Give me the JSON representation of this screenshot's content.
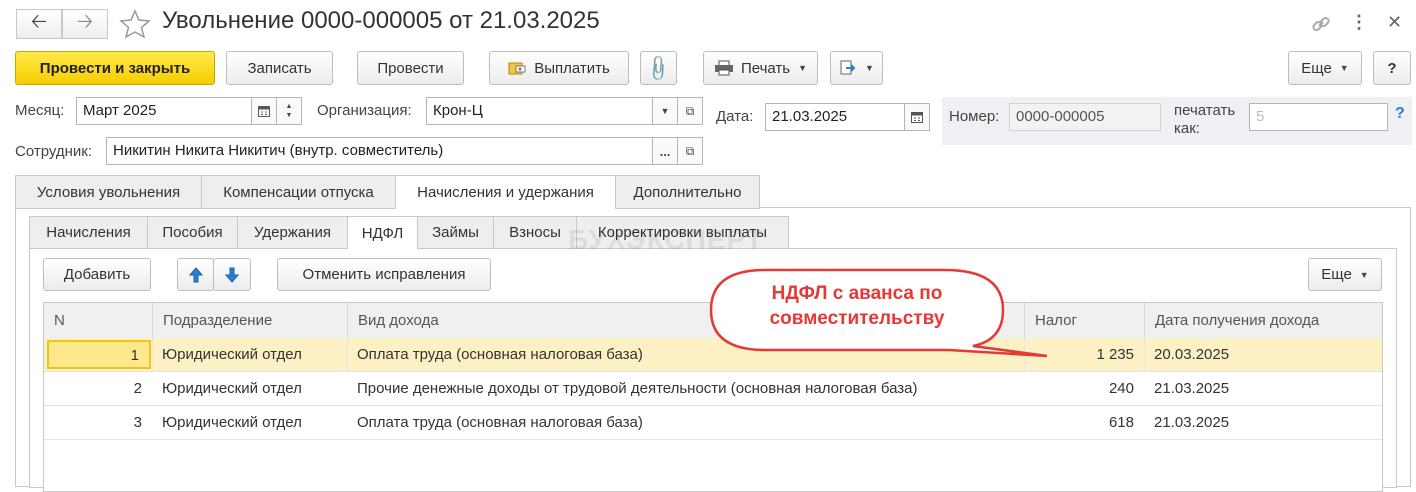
{
  "window": {
    "title": "Увольнение 0000-000005 от 21.03.2025",
    "icons": [
      "back-arrow-icon",
      "forward-arrow-icon",
      "star-icon",
      "link-icon",
      "more-vert-icon",
      "close-icon"
    ]
  },
  "toolbar": {
    "post_close": "Провести и закрыть",
    "save": "Записать",
    "post": "Провести",
    "pay": "Выплатить",
    "print": "Печать",
    "more": "Еще",
    "help": "?"
  },
  "form": {
    "month_label": "Месяц:",
    "month_value": "Март 2025",
    "org_label": "Организация:",
    "org_value": "Крон-Ц",
    "date_label": "Дата:",
    "date_value": "21.03.2025",
    "number_label": "Номер:",
    "number_value": "0000-000005",
    "print_as_label_1": "печатать",
    "print_as_label_2": "как:",
    "print_as_placeholder": "5",
    "print_as_help": "?",
    "employee_label": "Сотрудник:",
    "employee_value": "Никитин Никита Никитич (внутр. совместитель)",
    "ellipsis": "..."
  },
  "tabs": [
    {
      "label": "Условия увольнения"
    },
    {
      "label": "Компенсации отпуска"
    },
    {
      "label": "Начисления и удержания",
      "active": true
    },
    {
      "label": "Дополнительно"
    }
  ],
  "subtabs": [
    {
      "label": "Начисления"
    },
    {
      "label": "Пособия"
    },
    {
      "label": "Удержания"
    },
    {
      "label": "НДФЛ",
      "active": true
    },
    {
      "label": "Займы"
    },
    {
      "label": "Взносы"
    },
    {
      "label": "Корректировки выплаты"
    }
  ],
  "table_toolbar": {
    "add": "Добавить",
    "cancel_fix": "Отменить исправления",
    "more": "Еще"
  },
  "table": {
    "columns": [
      "N",
      "Подразделение",
      "Вид дохода",
      "Налог",
      "Дата получения дохода"
    ],
    "rows": [
      {
        "n": "1",
        "dept": "Юридический отдел",
        "income": "Оплата труда (основная налоговая база)",
        "tax": "1 235",
        "date": "20.03.2025"
      },
      {
        "n": "2",
        "dept": "Юридический отдел",
        "income": "Прочие денежные доходы от трудовой деятельности (основная налоговая база)",
        "tax": "240",
        "date": "21.03.2025"
      },
      {
        "n": "3",
        "dept": "Юридический отдел",
        "income": "Оплата труда (основная налоговая база)",
        "tax": "618",
        "date": "21.03.2025"
      }
    ]
  },
  "callout": {
    "line1": "НДФЛ с аванса по",
    "line2": "совместительству",
    "color": "#e53935"
  },
  "watermark": "БУХЭКСПЕРТ",
  "colors": {
    "accent": "#f6cd00",
    "selected_row": "#fbf1c4",
    "arrow_blue": "#2a7fd4"
  }
}
